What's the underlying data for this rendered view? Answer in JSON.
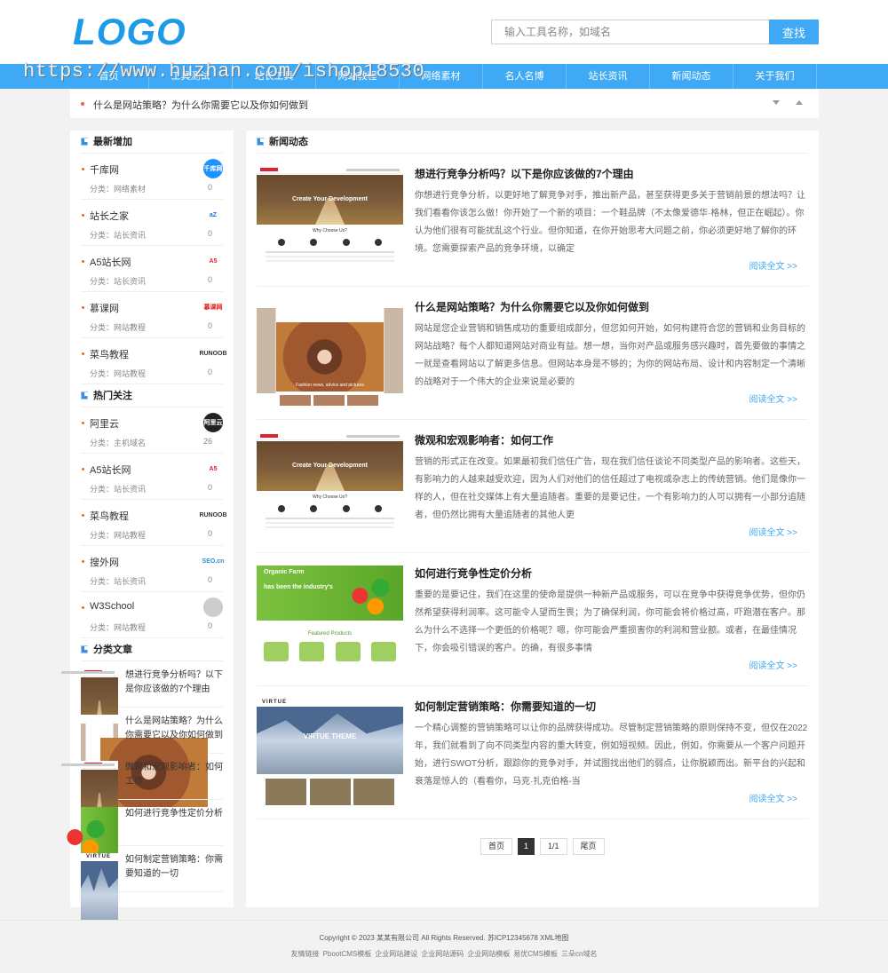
{
  "header": {
    "logo": "LOGO",
    "search_placeholder": "输入工具名称，如域名",
    "search_button": "查找"
  },
  "watermark": "https://www.huzhan.com/ishop18530",
  "nav": {
    "items": [
      "首页",
      "工具测试",
      "站长工具",
      "网站教程",
      "网络素材",
      "名人名博",
      "站长资讯",
      "新闻动态",
      "关于我们"
    ]
  },
  "notice": {
    "text": "什么是网站策略？为什么你需要它以及你如何做到"
  },
  "sidebar": {
    "latest": {
      "title": "最新增加",
      "items": [
        {
          "name": "千库网",
          "category": "分类：网络素材",
          "count": "0",
          "icon": "qianku-logo-icon",
          "icon_text": "千库网",
          "icon_bg": "#1e90ff",
          "icon_color": "#ffffff"
        },
        {
          "name": "站长之家",
          "category": "分类：站长资讯",
          "count": "0",
          "icon": "chinaz-logo-icon",
          "icon_text": "aZ",
          "icon_bg": "#ffffff",
          "icon_color": "#1e6fd8"
        },
        {
          "name": "A5站长网",
          "category": "分类：站长资讯",
          "count": "0",
          "icon": "a5-logo-icon",
          "icon_text": "A5",
          "icon_bg": "#ffffff",
          "icon_color": "#e02020"
        },
        {
          "name": "慕课网",
          "category": "分类：网站教程",
          "count": "0",
          "icon": "imooc-logo-icon",
          "icon_text": "慕课网",
          "icon_bg": "#ffffff",
          "icon_color": "#e02020"
        },
        {
          "name": "菜鸟教程",
          "category": "分类：网站教程",
          "count": "0",
          "icon": "runoob-logo-icon",
          "icon_text": "RUNOOB",
          "icon_bg": "#ffffff",
          "icon_color": "#333333"
        }
      ]
    },
    "hot": {
      "title": "热门关注",
      "items": [
        {
          "name": "阿里云",
          "category": "分类：主机域名",
          "count": "26",
          "icon": "aliyun-logo-icon",
          "icon_text": "阿里云",
          "icon_bg": "#222222",
          "icon_color": "#ffffff"
        },
        {
          "name": "A5站长网",
          "category": "分类：站长资讯",
          "count": "0",
          "icon": "a5-logo-icon",
          "icon_text": "A5",
          "icon_bg": "#ffffff",
          "icon_color": "#e02020"
        },
        {
          "name": "菜鸟教程",
          "category": "分类：网站教程",
          "count": "0",
          "icon": "runoob-logo-icon",
          "icon_text": "RUNOOB",
          "icon_bg": "#ffffff",
          "icon_color": "#333333"
        },
        {
          "name": "搜外网",
          "category": "分类：站长资讯",
          "count": "0",
          "icon": "seowhy-logo-icon",
          "icon_text": "SEO.cn",
          "icon_bg": "#ffffff",
          "icon_color": "#2a8fd8"
        },
        {
          "name": "W3School",
          "category": "分类：网站教程",
          "count": "0",
          "icon": "w3school-logo-icon",
          "icon_text": "",
          "icon_bg": "#cccccc",
          "icon_color": "#ffffff"
        }
      ]
    },
    "articles": {
      "title": "分类文章",
      "items": [
        {
          "title": "想进行竞争分析吗？以下是你应该做的7个理由",
          "thumb": "create"
        },
        {
          "title": "什么是网站策略？为什么你需要它以及你如何做到",
          "thumb": "fashion"
        },
        {
          "title": "微观和宏观影响者：如何工作",
          "thumb": "create"
        },
        {
          "title": "如何进行竞争性定价分析",
          "thumb": "farm"
        },
        {
          "title": "如何制定营销策略：你需要知道的一切",
          "thumb": "virtue"
        }
      ]
    }
  },
  "main": {
    "title": "新闻动态",
    "news": [
      {
        "title": "想进行竞争分析吗？以下是你应该做的7个理由",
        "summary": "你想进行竞争分析，以更好地了解竞争对手，推出新产品，甚至获得更多关于营销前景的想法吗？让我们看看你该怎么做！你开始了一个新的项目：一个鞋品牌（不太像爱德华·格林，但正在崛起）。你认为他们很有可能扰乱这个行业。但你知道，在你开始思考大问题之前，你必须更好地了解你的环境。您需要探索产品的竞争环境，以确定",
        "more": "阅读全文 >>",
        "thumb": "create"
      },
      {
        "title": "什么是网站策略？为什么你需要它以及你如何做到",
        "summary": "网站是您企业营销和销售成功的重要组成部分，但您如何开始，如何构建符合您的营销和业务目标的网站战略？每个人都知道网站对商业有益。想一想，当你对产品或服务感兴趣时，首先要做的事情之一就是查看网站以了解更多信息。但网站本身是不够的；为你的网站布局、设计和内容制定一个清晰的战略对于一个伟大的企业来说是必要的",
        "more": "阅读全文 >>",
        "thumb": "fashion"
      },
      {
        "title": "微观和宏观影响者：如何工作",
        "summary": "营销的形式正在改变。如果最初我们信任广告，现在我们信任谈论不同类型产品的影响者。这些天，有影响力的人越来越受欢迎，因为人们对他们的信任超过了电视或杂志上的传统营销。他们是像你一样的人，但在社交媒体上有大量追随者。重要的是要记住，一个有影响力的人可以拥有一小部分追随者，但仍然比拥有大量追随者的其他人更",
        "more": "阅读全文 >>",
        "thumb": "create"
      },
      {
        "title": "如何进行竞争性定价分析",
        "summary": "重要的是要记住，我们在这里的使命是提供一种新产品或服务，可以在竞争中获得竞争优势，但你仍然希望获得利润率。这可能令人望而生畏；为了确保利润，你可能会将价格过高，吓跑潜在客户。那么为什么不选择一个更低的价格呢？嗯，你可能会严重损害你的利润和营业额。或者，在最佳情况下，你会吸引错误的客户。的确，有很多事情",
        "more": "阅读全文 >>",
        "thumb": "farm"
      },
      {
        "title": "如何制定营销策略：你需要知道的一切",
        "summary": "一个精心调整的营销策略可以让你的品牌获得成功。尽管制定营销策略的原则保持不变，但仅在2022年，我们就看到了向不同类型内容的重大转变，例如短视频。因此，例如，你需要从一个客户问题开始，进行SWOT分析，跟踪你的竞争对手，并试图找出他们的弱点，让你脱颖而出。新平台的兴起和衰落是惊人的（看看你，马克·扎克伯格-当",
        "more": "阅读全文 >>",
        "thumb": "virtue"
      }
    ],
    "pager": {
      "first": "首页",
      "current": "1",
      "total": "1/1",
      "last": "尾页"
    }
  },
  "thumb_text": {
    "create": "Create Your Development",
    "why": "Why Choose Us?",
    "fashion": "Fashion news, advice and pictures",
    "farm_brand": "Organic Farm",
    "farm_title": "has been the industry's",
    "farm_sub": "Featured Products",
    "virtue_brand": "VIRTUE",
    "virtue_hero": "VIRTUE THEME"
  },
  "footer": {
    "copyright": "Copyright © 2023 某某有限公司 All Rights Reserved. 苏ICP12345678 XML地图",
    "links": [
      "友情链接",
      "PbootCMS模板",
      "企业网站建设",
      "企业网站源码",
      "企业网站模板",
      "易优CMS模板",
      "三朵cn域名"
    ]
  },
  "colors": {
    "accent": "#40a9f5",
    "logo": "#1e9be8",
    "bullet": "#e06a2c"
  }
}
